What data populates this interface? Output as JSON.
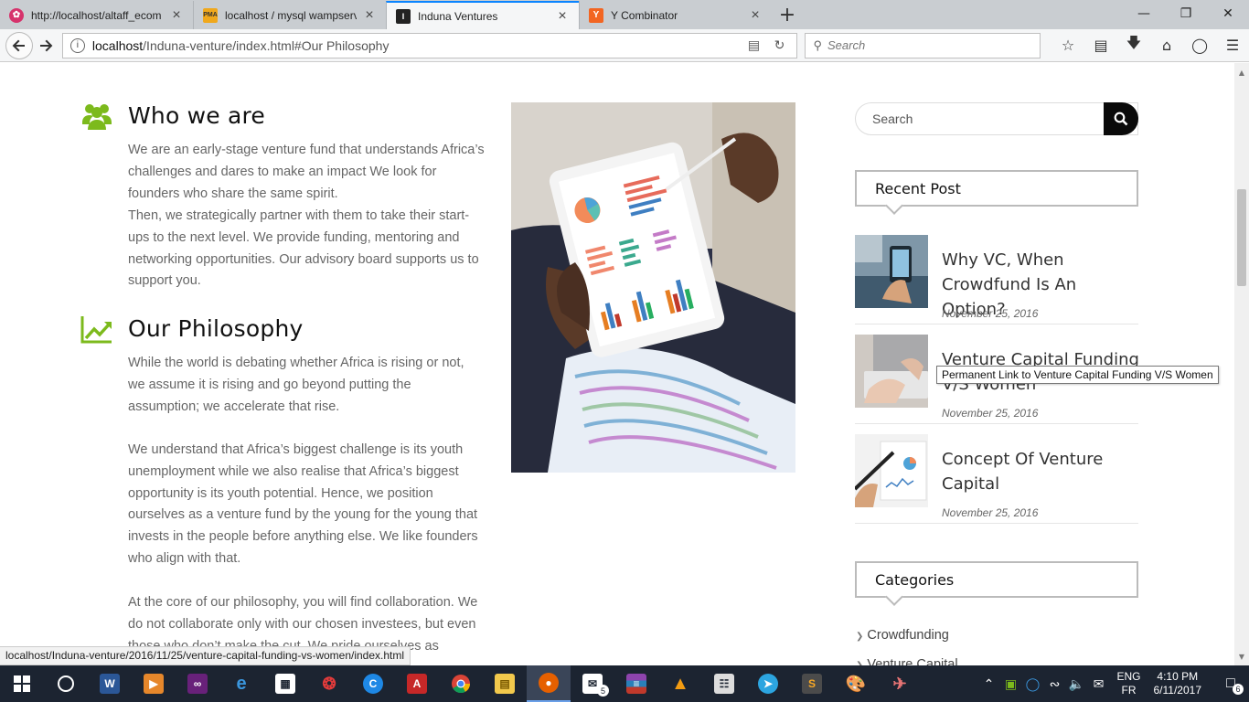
{
  "browser": {
    "tabs": [
      {
        "title": "http://localhost/altaff_ecom",
        "favicon": "invision-icon",
        "favicon_color": "#d6336c",
        "active": false
      },
      {
        "title": "localhost / mysql wampserv",
        "favicon": "phpmyadmin-icon",
        "favicon_color": "#f0a81c",
        "active": false
      },
      {
        "title": "Induna Ventures",
        "favicon": "induna-logo-icon",
        "favicon_color": "#222222",
        "active": true
      },
      {
        "title": "Y Combinator",
        "favicon": "ycombinator-icon",
        "favicon_color": "#f26522",
        "active": false
      }
    ],
    "url_host": "localhost",
    "url_path": "/Induna-venture/index.html#Our Philosophy",
    "search_placeholder": "Search"
  },
  "sections": [
    {
      "icon": "users-icon",
      "title": "Who we are",
      "paragraphs": [
        "We are an early-stage venture fund that understands Africa’s challenges and dares to make an impact We look for founders who share the same spirit.",
        "Then, we strategically partner with them to take their start-ups to the next level. We provide funding, mentoring and networking opportunities. Our advisory board supports us to support you."
      ]
    },
    {
      "icon": "trending-up-icon",
      "title": "Our Philosophy",
      "paragraphs": [
        "While the world is debating whether Africa is rising or not, we assume it is rising and go beyond putting the assumption; we accelerate that rise.",
        "We understand that Africa’s biggest challenge is its youth unemployment while we also realise that Africa’s biggest opportunity is its youth potential. Hence, we position ourselves as a venture fund by the young for the young that invests in the people before anything else. We like founders who align with that.",
        "At the core of our philosophy, you will find collaboration. We do not collaborate only with our chosen investees, but even those who don’t make the cut. We pride ourselves as"
      ]
    }
  ],
  "sidebar": {
    "search_placeholder": "Search",
    "recent_title": "Recent Post",
    "posts": [
      {
        "title": "Why VC, When Crowdfund Is An Option?",
        "date": "November 25, 2016"
      },
      {
        "title": "Venture Capital Funding V/S Women",
        "date": "November 25, 2016"
      },
      {
        "title": "Concept Of Venture Capital",
        "date": "November 25, 2016"
      }
    ],
    "tooltip": "Permanent Link to Venture Capital Funding V/S Women",
    "categories_title": "Categories",
    "categories": [
      "Crowdfunding",
      "Venture Capital"
    ]
  },
  "status_url": "localhost/Induna-venture/2016/11/25/venture-capital-funding-vs-women/index.html",
  "taskbar": {
    "apps": [
      "windows-start-icon",
      "cortana-icon",
      "word-icon",
      "media-player-icon",
      "visual-studio-icon",
      "edge-icon",
      "store-icon",
      "app-red-icon",
      "app-blue-icon",
      "acrobat-icon",
      "chrome-icon",
      "file-explorer-icon",
      "firefox-icon",
      "mail-icon",
      "winrar-icon",
      "vlc-icon",
      "app-columns-icon",
      "telegram-icon",
      "sublime-icon",
      "paint-icon",
      "app-plane-icon"
    ],
    "mail_badge": "5",
    "lang_top": "ENG",
    "lang_bottom": "FR",
    "time": "4:10 PM",
    "date": "6/11/2017",
    "notif_badge": "6",
    "accent": "#7cba1c"
  }
}
